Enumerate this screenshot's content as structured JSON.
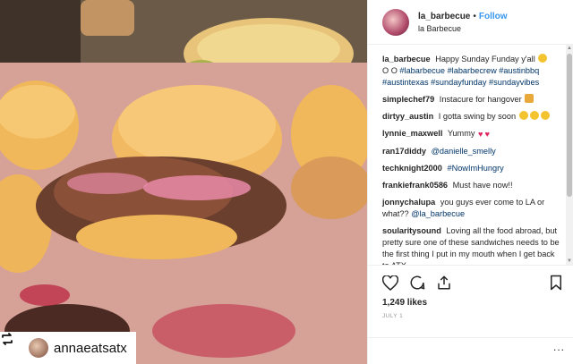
{
  "post": {
    "username": "la_barbecue",
    "separator": "•",
    "follow_label": "Follow",
    "location": "la Barbecue",
    "likes": "1,249 likes",
    "date": "JULY 1",
    "more_label": "..."
  },
  "caption": {
    "user": "la_barbecue",
    "text": "Happy Sunday Funday y'all",
    "line2_prefix": "O O",
    "tags": [
      "#labarbecue",
      "#labarbecrew",
      "#austinbbq",
      "#austintexas",
      "#sundayfunday",
      "#sundayvibes"
    ]
  },
  "comments": [
    {
      "user": "simplechef79",
      "text": "Instacure for hangover"
    },
    {
      "user": "dirtyy_austin",
      "text": "I gotta swing by soon"
    },
    {
      "user": "lynnie_maxwell",
      "text": "Yummy"
    },
    {
      "user": "ran17diddy",
      "text": "@danielle_smelly"
    },
    {
      "user": "techknight2000",
      "text": "#NowImHungry"
    },
    {
      "user": "frankiefrank0586",
      "text": "Must have now!!"
    },
    {
      "user": "jonnychalupa",
      "text": "you guys ever come to LA or what??",
      "mention": "@la_barbecue"
    },
    {
      "user": "soularitysound",
      "text": "Loving all the food abroad, but pretty sure one of these sandwiches needs to be the first thing I put in my mouth when I get back to ATX...."
    }
  ],
  "repost": {
    "username": "annaeatsatx"
  },
  "colors": {
    "link": "#3897f0",
    "hashtag": "#003569",
    "heart": "#e0245e"
  },
  "icons": [
    "heart-icon",
    "comment-icon",
    "share-icon",
    "bookmark-icon",
    "repost-icon"
  ]
}
